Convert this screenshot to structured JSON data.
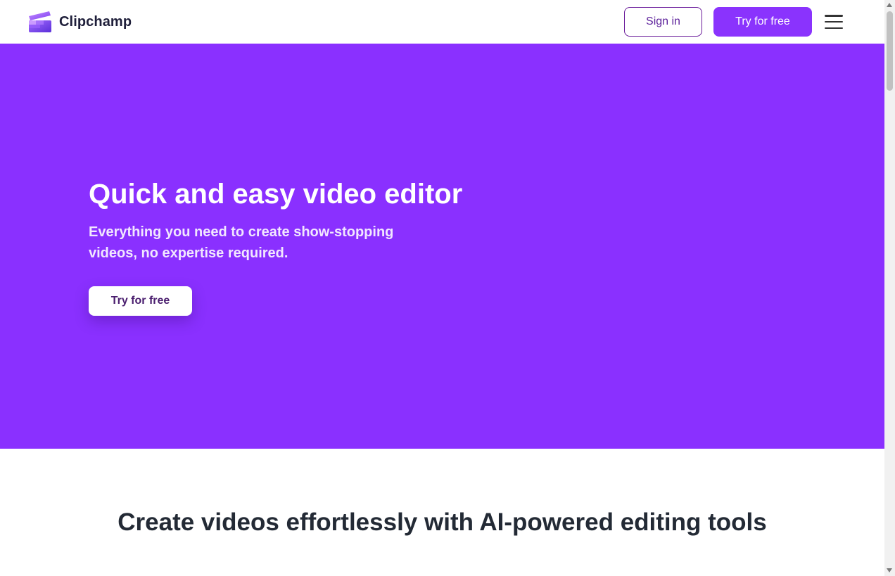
{
  "header": {
    "brand": "Clipchamp",
    "logo_icon": "clapperboard-logo-icon",
    "sign_in_label": "Sign in",
    "try_label": "Try for free",
    "menu_icon": "hamburger-menu-icon"
  },
  "hero": {
    "title": "Quick and easy video editor",
    "subtitle": "Everything you need to create show-stopping videos, no expertise required.",
    "cta_label": "Try for free",
    "background": "#8a30ff"
  },
  "section": {
    "title": "Create videos effortlessly with AI-powered editing tools"
  },
  "colors": {
    "accent": "#8a33fd",
    "text_dark": "#232a35"
  }
}
